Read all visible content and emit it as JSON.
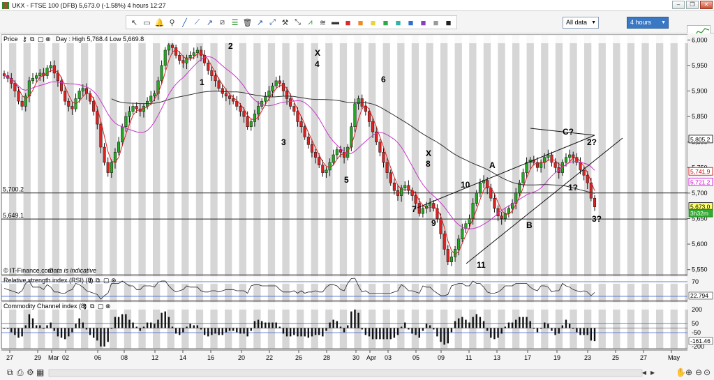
{
  "window": {
    "title": "UKX - FTSE 100 (DFB)    5,673.0 (-1.58%)    4 hours   12:27",
    "buttons": [
      "–",
      "❐",
      "✕"
    ]
  },
  "toolbar": {
    "data_range": "All data",
    "period": "4 hours",
    "tools": [
      {
        "name": "cursor-icon",
        "glyph": "↖"
      },
      {
        "name": "ruler-icon",
        "glyph": "▭"
      },
      {
        "name": "bell-icon",
        "glyph": "🔔"
      },
      {
        "name": "zoom-icon",
        "glyph": "⚲"
      },
      {
        "name": "line-icon",
        "glyph": "╱"
      },
      {
        "name": "hline-icon",
        "glyph": "⟋"
      },
      {
        "name": "vline-icon",
        "glyph": "↗"
      },
      {
        "name": "channel-icon",
        "glyph": "⧄"
      },
      {
        "name": "fib-icon",
        "glyph": "☰"
      },
      {
        "name": "delete-icon",
        "glyph": "🗑"
      },
      {
        "name": "arrow-icon",
        "glyph": "↗"
      },
      {
        "name": "ray-icon",
        "glyph": "⤢"
      },
      {
        "name": "tools-icon",
        "glyph": "⚒"
      },
      {
        "name": "gann-icon",
        "glyph": "⤡"
      },
      {
        "name": "pitchfork-icon",
        "glyph": "⩘"
      },
      {
        "name": "text-icon",
        "glyph": "≋"
      },
      {
        "name": "rect-icon",
        "glyph": "▬"
      },
      {
        "name": "color-red-icon",
        "glyph": "■"
      },
      {
        "name": "color-orange-icon",
        "glyph": "■"
      },
      {
        "name": "color-yellow-icon",
        "glyph": "■"
      },
      {
        "name": "color-green-icon",
        "glyph": "■"
      },
      {
        "name": "color-teal-icon",
        "glyph": "■"
      },
      {
        "name": "color-blue-icon",
        "glyph": "■"
      },
      {
        "name": "color-purple-icon",
        "glyph": "■"
      },
      {
        "name": "color-grey-icon",
        "glyph": "■"
      },
      {
        "name": "color-black-icon",
        "glyph": "■"
      }
    ]
  },
  "price_panel": {
    "label": "Price",
    "info": "Day : High 5,768.4  Low 5,669.8",
    "source": "© IT-Finance.com",
    "source_note": "Data is indicative",
    "y_ticks": [
      "6,000",
      "5,950",
      "5,900",
      "5,850",
      "5,800",
      "5,750",
      "5,700",
      "5,650",
      "5,600",
      "5,550"
    ],
    "hlines": [
      {
        "label": "5,700.2",
        "value": 5700.2
      },
      {
        "label": "5,649.1",
        "value": 5649.1
      }
    ],
    "right_tags": [
      {
        "label": "5,805.2",
        "value": 5805.2,
        "bg": "#ffffff",
        "fg": "#000000",
        "border": "#000000"
      },
      {
        "label": "5,741.9",
        "value": 5741.9,
        "bg": "#ffffff",
        "fg": "#cc0000",
        "border": "#cc0000"
      },
      {
        "label": "5,721.2",
        "value": 5721.2,
        "bg": "#ffffff",
        "fg": "#cc00cc",
        "border": "#cc00cc"
      },
      {
        "label": "5,673.0",
        "value": 5673.0,
        "bg": "#ffff66",
        "fg": "#000000",
        "border": "#000000"
      },
      {
        "label": "3h32m",
        "value": 5660.0,
        "bg": "#33aa33",
        "fg": "#ffffff",
        "border": "#1f7a1f"
      }
    ],
    "wave_labels": [
      {
        "text": "1",
        "x": 290,
        "y": 118
      },
      {
        "text": "2",
        "x": 331,
        "y": 66
      },
      {
        "text": "X",
        "x": 455,
        "y": 76
      },
      {
        "text": "4",
        "x": 455,
        "y": 92
      },
      {
        "text": "3",
        "x": 407,
        "y": 204
      },
      {
        "text": "5",
        "x": 497,
        "y": 258
      },
      {
        "text": "6",
        "x": 550,
        "y": 114
      },
      {
        "text": "X",
        "x": 614,
        "y": 220
      },
      {
        "text": "8",
        "x": 614,
        "y": 235
      },
      {
        "text": "7",
        "x": 594,
        "y": 300
      },
      {
        "text": "9",
        "x": 622,
        "y": 320
      },
      {
        "text": "10",
        "x": 664,
        "y": 265
      },
      {
        "text": "11",
        "x": 687,
        "y": 380
      },
      {
        "text": "A",
        "x": 705,
        "y": 237
      },
      {
        "text": "B",
        "x": 758,
        "y": 323
      },
      {
        "text": "C?",
        "x": 810,
        "y": 189
      },
      {
        "text": "2?",
        "x": 845,
        "y": 204
      },
      {
        "text": "1?",
        "x": 818,
        "y": 269
      },
      {
        "text": "3?",
        "x": 852,
        "y": 314
      }
    ],
    "colors": {
      "up": "#22aa22",
      "down": "#dd2222",
      "ma_short": "#e02020",
      "ma_mid": "#cc33cc",
      "ma_long": "#333333"
    }
  },
  "rsi_panel": {
    "label": "Relative strength index (RSI) (8)",
    "ticks": [
      "70",
      "30"
    ],
    "value_tag": "22.794"
  },
  "cci_panel": {
    "label": "Commodity Channel index (8)",
    "ticks": [
      "200",
      "50",
      "-50",
      "-200"
    ],
    "value_tag": "-161.46"
  },
  "x_axis": {
    "labels": [
      "27",
      "29",
      "Mar",
      "02",
      "06",
      "08",
      "12",
      "14",
      "16",
      "20",
      "22",
      "26",
      "28",
      "30",
      "Apr",
      "03",
      "05",
      "09",
      "11",
      "13",
      "17",
      "19",
      "23",
      "25",
      "27",
      "May"
    ]
  },
  "chart_data": {
    "type": "candlestick",
    "title": "UKX - FTSE 100 (DFB)",
    "ylim": [
      5540,
      6010
    ],
    "series": [
      {
        "name": "Price",
        "values": [
          5930,
          5925,
          5915,
          5900,
          5880,
          5870,
          5890,
          5920,
          5925,
          5930,
          5935,
          5930,
          5945,
          5950,
          5935,
          5920,
          5900,
          5880,
          5870,
          5865,
          5885,
          5900,
          5905,
          5895,
          5880,
          5860,
          5835,
          5790,
          5760,
          5740,
          5760,
          5780,
          5800,
          5830,
          5850,
          5860,
          5870,
          5865,
          5860,
          5870,
          5880,
          5890,
          5895,
          5920,
          5950,
          5980,
          5990,
          5985,
          5970,
          5960,
          5955,
          5965,
          5970,
          5975,
          5980,
          5970,
          5955,
          5940,
          5930,
          5920,
          5905,
          5895,
          5890,
          5885,
          5880,
          5870,
          5860,
          5850,
          5830,
          5840,
          5855,
          5870,
          5880,
          5890,
          5900,
          5910,
          5920,
          5915,
          5900,
          5885,
          5870,
          5860,
          5840,
          5830,
          5810,
          5795,
          5780,
          5770,
          5755,
          5740,
          5745,
          5760,
          5775,
          5785,
          5780,
          5770,
          5790,
          5830,
          5875,
          5885,
          5870,
          5860,
          5840,
          5820,
          5800,
          5780,
          5760,
          5740,
          5720,
          5705,
          5695,
          5710,
          5715,
          5705,
          5695,
          5680,
          5660,
          5670,
          5675,
          5680,
          5670,
          5650,
          5620,
          5590,
          5565,
          5575,
          5590,
          5610,
          5630,
          5640,
          5650,
          5680,
          5700,
          5720,
          5725,
          5710,
          5690,
          5670,
          5655,
          5650,
          5660,
          5670,
          5680,
          5700,
          5720,
          5740,
          5760,
          5765,
          5760,
          5750,
          5760,
          5770,
          5775,
          5760,
          5750,
          5740,
          5760,
          5770,
          5775,
          5770,
          5760,
          5745,
          5735,
          5720,
          5690,
          5673
        ]
      },
      {
        "name": "MA short",
        "values": []
      },
      {
        "name": "MA mid",
        "values": []
      },
      {
        "name": "MA long",
        "values": []
      }
    ]
  }
}
